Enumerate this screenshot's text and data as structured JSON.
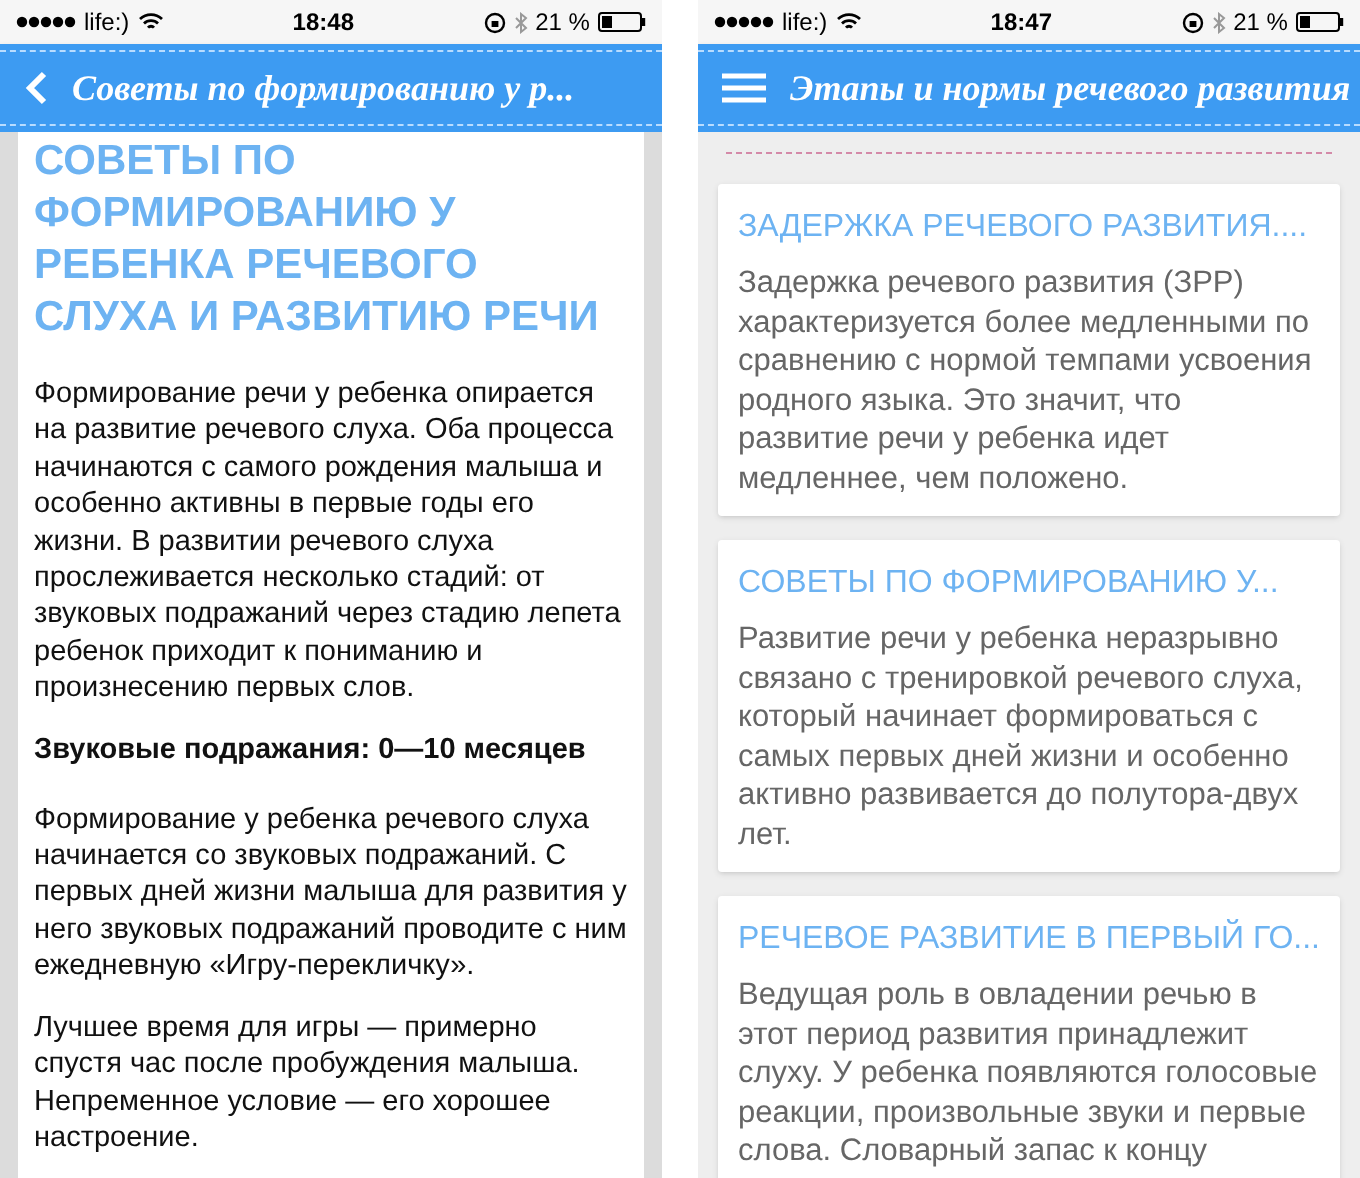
{
  "screens": [
    {
      "status_bar": {
        "carrier": "life:)",
        "time": "18:48",
        "battery": "21 %"
      },
      "nav_bar": {
        "kind": "back",
        "title": "Советы по формированию у р..."
      },
      "article": {
        "title": "СОВЕТЫ ПО ФОРМИРОВАНИЮ У РЕБЕНКА РЕЧЕВОГО СЛУХА И РАЗВИТИЮ РЕЧИ",
        "blocks": [
          {
            "kind": "paragraph",
            "text": "Формирование речи у ребенка опирается на развитие речевого слуха. Оба процесса начинаются с самого рождения малыша и особенно активны в первые годы его жизни. В развитии речевого слуха прослеживается несколько стадий: от звуковых подражаний через стадию лепета ребенок приходит к пониманию и произнесению первых слов."
          },
          {
            "kind": "heading",
            "text": "Звуковые подражания: 0—10 месяцев"
          },
          {
            "kind": "paragraph",
            "text": "Формирование у ребенка речевого слуха начинается со звуковых подражаний. С первых дней жизни малыша для развития у него звуковых подражаний проводите с ним ежедневную «Игру-перекличку»."
          },
          {
            "kind": "paragraph",
            "text": "Лучшее время для игры — примерно спустя час после пробуждения малыша. Непременное условие — его хорошее настроение."
          }
        ]
      }
    },
    {
      "status_bar": {
        "carrier": "life:)",
        "time": "18:47",
        "battery": "21 %"
      },
      "nav_bar": {
        "kind": "menu",
        "title": "Этапы и нормы речевого развития"
      },
      "cards": [
        {
          "title": "ЗАДЕРЖКА РЕЧЕВОГО РАЗВИТИЯ....",
          "text": "Задержка речевого развития (ЗРР) характеризуется более медленными по сравнению с нормой темпами усвоения родного языка. Это значит, что развитие речи у ребенка идет медленнее, чем положено."
        },
        {
          "title": "СОВЕТЫ ПО ФОРМИРОВАНИЮ У...",
          "text": "Развитие речи у ребенка неразрывно связано с тренировкой речевого слуха, который начинает формироваться с самых первых дней жизни и особенно активно развивается до полутора-двух лет."
        },
        {
          "title": "РЕЧЕВОЕ РАЗВИТИЕ В ПЕРВЫЙ ГО...",
          "text": "Ведущая роль в овладении речью в этот период развития принадлежит слуху. У ребенка появляются голосовые реакции, произвольные звуки и первые слова. Словарный запас к концу"
        }
      ]
    }
  ]
}
